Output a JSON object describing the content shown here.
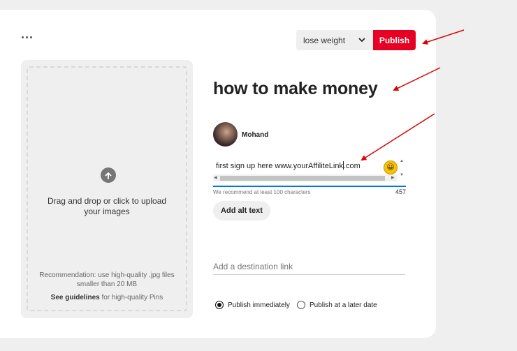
{
  "toolbar": {
    "more_icon": "more-dots-icon",
    "board": "lose weight",
    "publish": "Publish"
  },
  "upload": {
    "icon": "upload-arrow-icon",
    "drop_text": "Drag and drop or click to upload your images",
    "recommendation": "Recommendation: use high-quality .jpg files smaller than 20 MB",
    "guidelines_link": "See guidelines",
    "guidelines_suffix": " for high-quality Pins"
  },
  "pin": {
    "title": "how to make money",
    "author": "Mohand",
    "description_before_caret": "first sign up here www.yourAffiliteLink",
    "description_after_caret": ".com",
    "emoji": "😀",
    "hint": "We recommend at least 100 characters",
    "char_count": "457",
    "alt_text_button": "Add alt text",
    "destination_placeholder": "Add a destination link"
  },
  "schedule": {
    "options": [
      {
        "label": "Publish immediately",
        "selected": true
      },
      {
        "label": "Publish at a later date",
        "selected": false
      }
    ]
  },
  "colors": {
    "accent": "#e60023",
    "annotation_arrow": "#e00000",
    "focus_blue": "#0074e8"
  }
}
